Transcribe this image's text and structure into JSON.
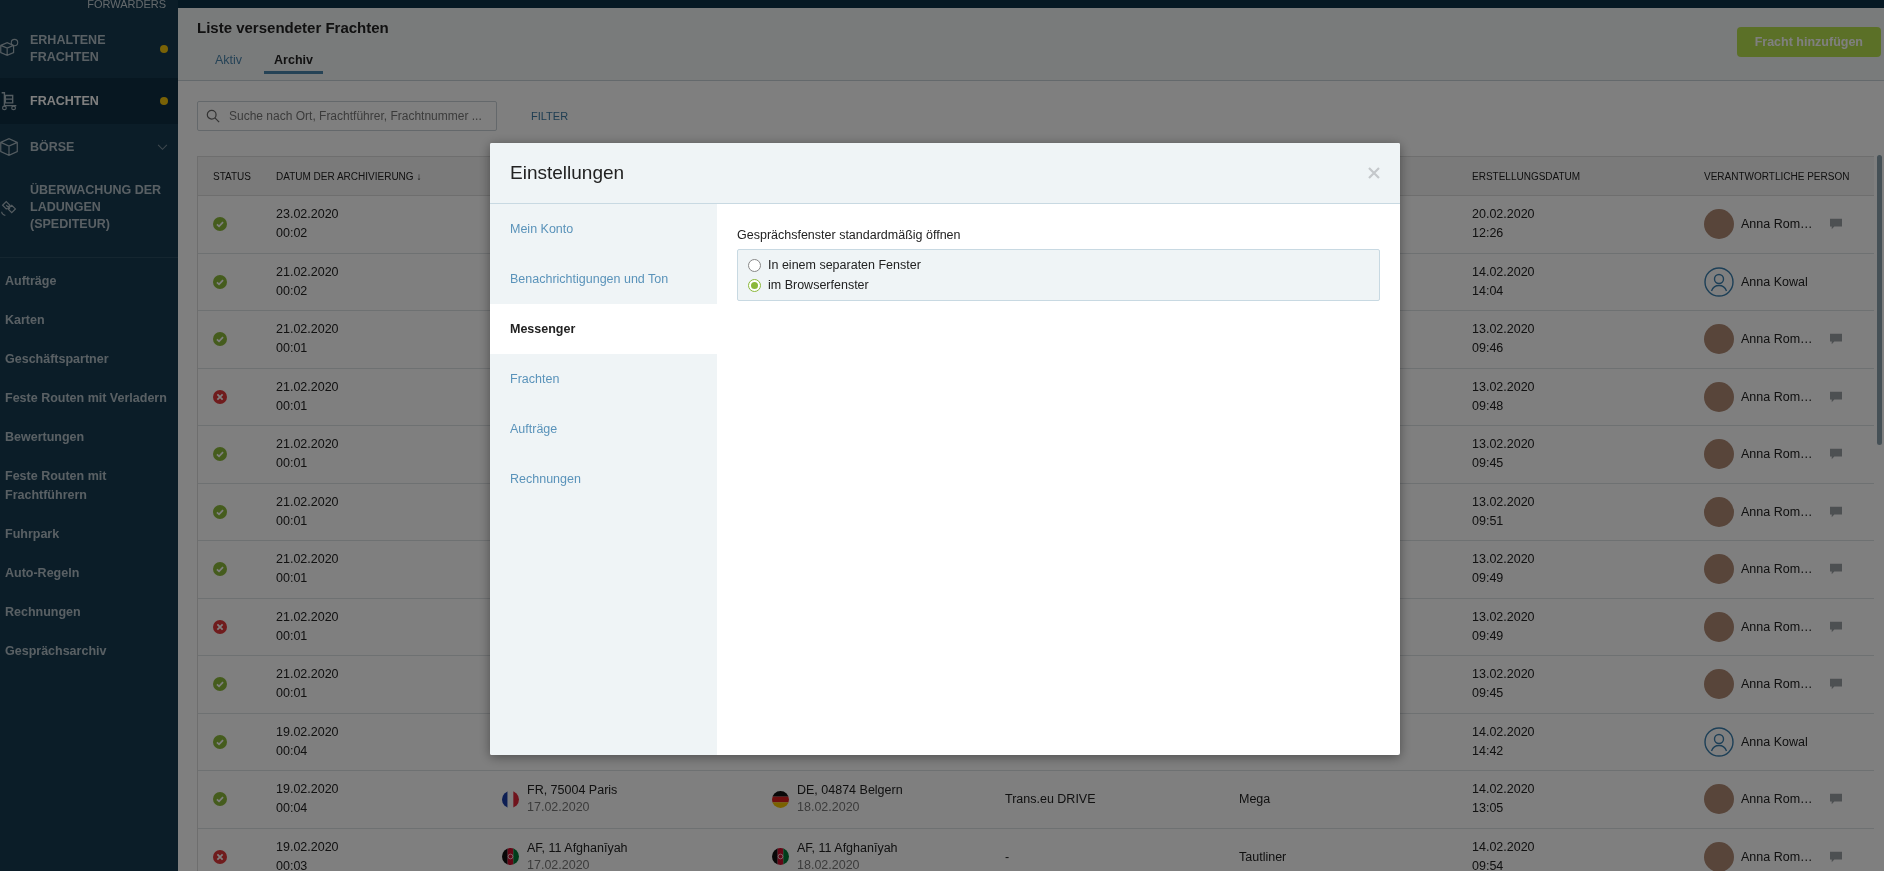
{
  "sidebar": {
    "brand": "FORWARDERS",
    "modules": [
      {
        "kind": "received",
        "label": "ERHALTENE FRACHTEN",
        "selected": false,
        "dot": true,
        "expandable": false
      },
      {
        "kind": "freights",
        "label": "FRACHTEN",
        "selected": true,
        "dot": true,
        "expandable": false
      },
      {
        "kind": "exchange",
        "label": "BÖRSE",
        "selected": false,
        "dot": false,
        "expandable": true
      },
      {
        "kind": "tracking",
        "label": "ÜBERWACHUNG DER LADUNGEN (SPEDITEUR)",
        "selected": false,
        "dot": false,
        "expandable": false
      }
    ],
    "items": [
      "Aufträge",
      "Karten",
      "Geschäftspartner",
      "Feste Routen mit Verladern",
      "Bewertungen",
      "Feste Routen mit Frachtführern",
      "Fuhrpark",
      "Auto-Regeln",
      "Rechnungen",
      "Gesprächsarchiv"
    ]
  },
  "header": {
    "title": "Liste versendeter Frachten",
    "add_button": "Fracht hinzufügen",
    "tabs": [
      {
        "label": "Aktiv",
        "selected": false
      },
      {
        "label": "Archiv",
        "selected": true
      }
    ]
  },
  "search": {
    "placeholder": "Suche nach Ort, Frachtführer, Frachtnummer ..."
  },
  "filter_button": "FILTER",
  "table": {
    "columns": [
      "STATUS",
      "DATUM DER ARCHIVIERUNG ↓",
      "ERSTELLUNGSDATUM",
      "VERANTWORTLICHE PERSON"
    ],
    "rows": [
      {
        "kind": "done",
        "archived": [
          "23.02.2020",
          "00:02"
        ],
        "created": [
          "20.02.2020",
          "12:26"
        ],
        "person": {
          "kind": "photo",
          "name": "Anna Rom…",
          "chat": true
        }
      },
      {
        "kind": "done",
        "archived": [
          "21.02.2020",
          "00:02"
        ],
        "created": [
          "14.02.2020",
          "14:04"
        ],
        "person": {
          "kind": "generic",
          "name": "Anna Kowal",
          "chat": false
        }
      },
      {
        "kind": "done",
        "archived": [
          "21.02.2020",
          "00:01"
        ],
        "created": [
          "13.02.2020",
          "09:46"
        ],
        "person": {
          "kind": "photo",
          "name": "Anna Rom…",
          "chat": true
        }
      },
      {
        "kind": "cancelled",
        "archived": [
          "21.02.2020",
          "00:01"
        ],
        "created": [
          "13.02.2020",
          "09:48"
        ],
        "person": {
          "kind": "photo",
          "name": "Anna Rom…",
          "chat": true
        }
      },
      {
        "kind": "done",
        "archived": [
          "21.02.2020",
          "00:01"
        ],
        "created": [
          "13.02.2020",
          "09:45"
        ],
        "person": {
          "kind": "photo",
          "name": "Anna Rom…",
          "chat": true
        }
      },
      {
        "kind": "done",
        "archived": [
          "21.02.2020",
          "00:01"
        ],
        "created": [
          "13.02.2020",
          "09:51"
        ],
        "person": {
          "kind": "photo",
          "name": "Anna Rom…",
          "chat": true
        }
      },
      {
        "kind": "done",
        "archived": [
          "21.02.2020",
          "00:01"
        ],
        "created": [
          "13.02.2020",
          "09:49"
        ],
        "person": {
          "kind": "photo",
          "name": "Anna Rom…",
          "chat": true
        }
      },
      {
        "kind": "cancelled",
        "archived": [
          "21.02.2020",
          "00:01"
        ],
        "created": [
          "13.02.2020",
          "09:49"
        ],
        "person": {
          "kind": "photo",
          "name": "Anna Rom…",
          "chat": true
        }
      },
      {
        "kind": "done",
        "archived": [
          "21.02.2020",
          "00:01"
        ],
        "created": [
          "13.02.2020",
          "09:45"
        ],
        "person": {
          "kind": "photo",
          "name": "Anna Rom…",
          "chat": true
        }
      },
      {
        "kind": "done",
        "archived": [
          "19.02.2020",
          "00:04"
        ],
        "created": [
          "14.02.2020",
          "14:42"
        ],
        "person": {
          "kind": "generic",
          "name": "Anna Kowal",
          "chat": false
        }
      },
      {
        "kind": "done",
        "archived": [
          "19.02.2020",
          "00:04"
        ],
        "from": {
          "kind": "fr",
          "place": "FR, 75004 Paris",
          "date": "17.02.2020"
        },
        "to": {
          "kind": "de",
          "place": "DE, 04874 Belgern",
          "date": "18.02.2020"
        },
        "column_5": "Trans.eu DRIVE",
        "column_6": "Mega",
        "created": [
          "14.02.2020",
          "13:05"
        ],
        "person": {
          "kind": "photo",
          "name": "Anna Rom…",
          "chat": true
        }
      },
      {
        "kind": "cancelled",
        "archived": [
          "19.02.2020",
          "00:03"
        ],
        "from": {
          "kind": "af",
          "place": "AF, 11 Afghanīyah",
          "date": "17.02.2020"
        },
        "to": {
          "kind": "af",
          "place": "AF, 11 Afghanīyah",
          "date": "18.02.2020"
        },
        "column_5": "-",
        "column_6": "Tautliner",
        "created": [
          "14.02.2020",
          "09:54"
        ],
        "person": {
          "kind": "photo",
          "name": "Anna Rom…",
          "chat": true
        }
      }
    ]
  },
  "dialog": {
    "title": "Einstellungen",
    "nav": [
      {
        "label": "Mein Konto",
        "selected": false
      },
      {
        "label": "Benachrichtigungen und Ton",
        "selected": false
      },
      {
        "label": "Messenger",
        "selected": true
      },
      {
        "label": "Frachten",
        "selected": false
      },
      {
        "label": "Aufträge",
        "selected": false
      },
      {
        "label": "Rechnungen",
        "selected": false
      }
    ],
    "setting_label": "Gesprächsfenster standardmäßig öffnen",
    "options": [
      {
        "label": "In einem separaten Fenster",
        "selected": false
      },
      {
        "label": "im Browserfenster",
        "selected": true
      }
    ]
  }
}
